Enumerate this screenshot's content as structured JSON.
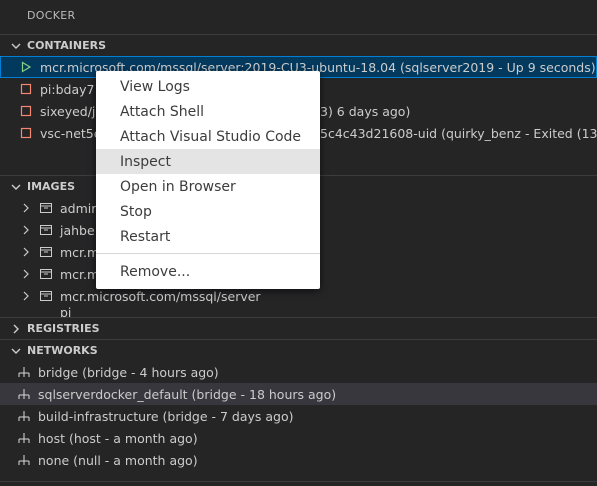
{
  "title": "DOCKER",
  "sections": {
    "containers": "CONTAINERS",
    "images": "IMAGES",
    "registries": "REGISTRIES",
    "networks": "NETWORKS"
  },
  "containers": [
    {
      "label": "mcr.microsoft.com/mssql/server:2019-CU3-ubuntu-18.04 (sqlserver2019 - Up 9 seconds)",
      "status": "running"
    },
    {
      "label": "pi:bday7 (",
      "status": "stopped"
    },
    {
      "label": "sixeyed/je",
      "tail": "3) 6 days ago)",
      "status": "stopped"
    },
    {
      "label": "vsc-net5c",
      "tail": "5c4c43d21608-uid (quirky_benz - Exited (13...",
      "status": "stopped"
    }
  ],
  "images": [
    {
      "label": "admir"
    },
    {
      "label": "jahbe"
    },
    {
      "label": "mcr.m"
    },
    {
      "label": "mcr.m"
    },
    {
      "label": "mcr.microsoft.com/mssql/server"
    },
    {
      "label": "pi"
    }
  ],
  "networks": [
    {
      "label": "bridge (bridge - 4 hours ago)"
    },
    {
      "label": "sqlserverdocker_default (bridge - 18 hours ago)"
    },
    {
      "label": "build-infrastructure (bridge - 7 days ago)"
    },
    {
      "label": "host (host - a month ago)"
    },
    {
      "label": "none (null - a month ago)"
    }
  ],
  "context_menu": {
    "items": [
      "View Logs",
      "Attach Shell",
      "Attach Visual Studio Code",
      "Inspect",
      "Open in Browser",
      "Stop",
      "Restart"
    ],
    "remove": "Remove...",
    "active": "Inspect"
  },
  "colors": {
    "background": "#252526",
    "selection": "#04395e",
    "selection_border": "#007fd4",
    "running_icon": "#89d185",
    "stopped_icon": "#f48771",
    "menu_bg": "#ffffff"
  }
}
